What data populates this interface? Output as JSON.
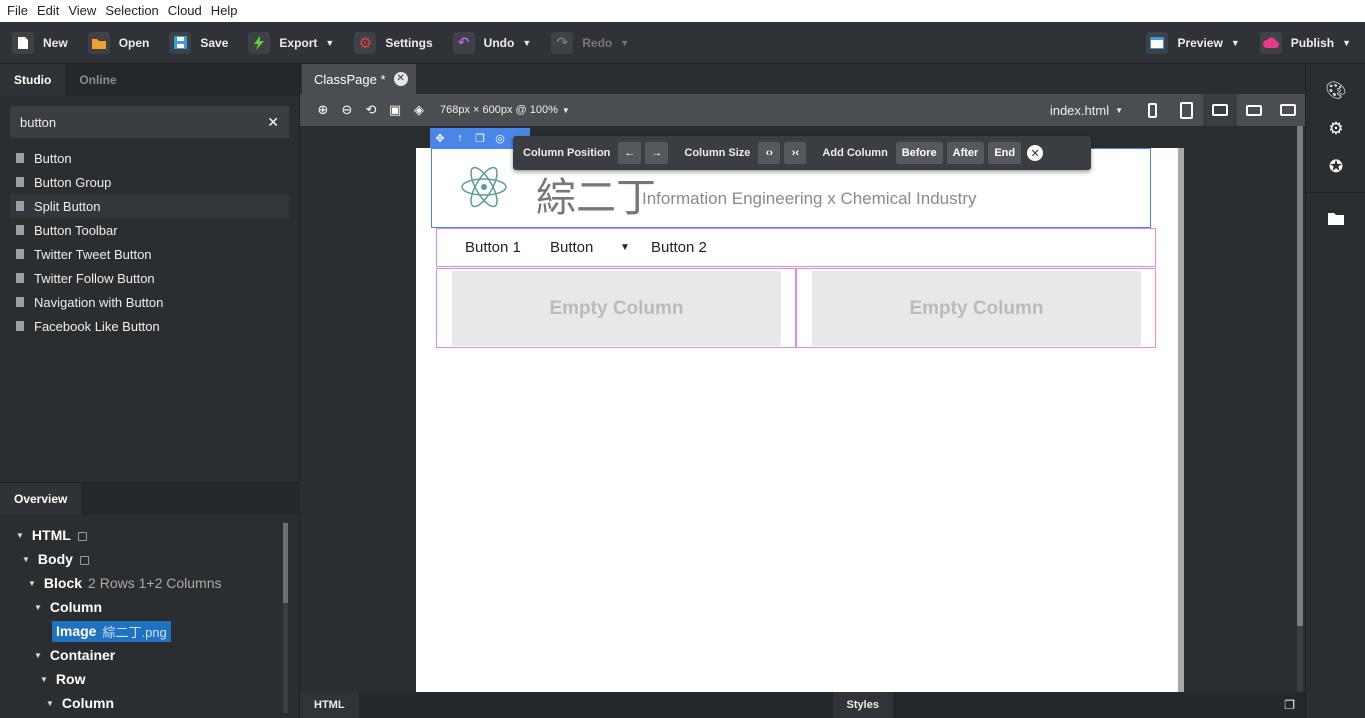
{
  "menu": [
    "File",
    "Edit",
    "View",
    "Selection",
    "Cloud",
    "Help"
  ],
  "toolbar": {
    "new": "New",
    "open": "Open",
    "save": "Save",
    "export": "Export",
    "settings": "Settings",
    "undo": "Undo",
    "redo": "Redo",
    "preview": "Preview",
    "publish": "Publish"
  },
  "left": {
    "tabs": [
      "Studio",
      "Online"
    ],
    "search_value": "button",
    "components": [
      "Button",
      "Button Group",
      "Split Button",
      "Button Toolbar",
      "Twitter Tweet Button",
      "Twitter Follow Button",
      "Navigation with Button",
      "Facebook Like Button"
    ]
  },
  "overview": {
    "tab": "Overview",
    "tree": [
      {
        "label": "HTML",
        "sub": "",
        "lock": true
      },
      {
        "label": "Body",
        "sub": "",
        "lock": true
      },
      {
        "label": "Block",
        "sub": "2 Rows 1+2 Columns"
      },
      {
        "label": "Column",
        "sub": ""
      },
      {
        "label": "Image",
        "sub": "綜二丁.png",
        "selected": true
      },
      {
        "label": "Container",
        "sub": ""
      },
      {
        "label": "Row",
        "sub": ""
      },
      {
        "label": "Column",
        "sub": ""
      }
    ]
  },
  "editor": {
    "doc_tab": "ClassPage *",
    "viewport": "768px × 600px @ 100%",
    "file": "index.html"
  },
  "colbar": {
    "position": "Column Position",
    "size": "Column Size",
    "add": "Add Column",
    "before": "Before",
    "after": "After",
    "end": "End"
  },
  "page": {
    "logo_cn": "綜二丁",
    "logo_sub": "Information Engineering x Chemical Industry",
    "nav": [
      "Button 1",
      "Button",
      "Button 2"
    ],
    "empty": "Empty Column"
  },
  "bottom": {
    "html": "HTML",
    "styles": "Styles"
  }
}
